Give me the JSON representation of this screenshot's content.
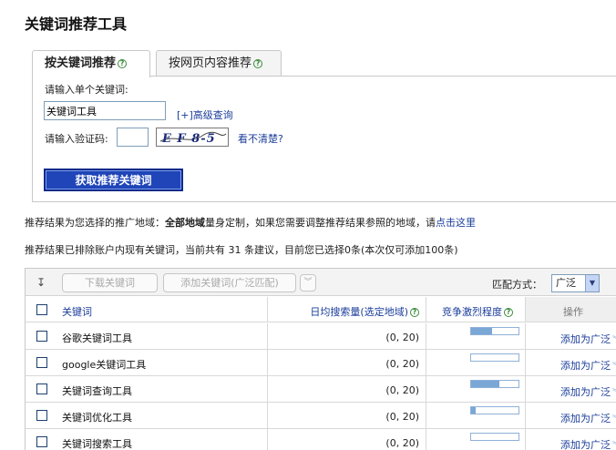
{
  "page_title": "关键词推荐工具",
  "tabs": [
    {
      "label": "按关键词推荐",
      "active": true
    },
    {
      "label": "按网页内容推荐",
      "active": false
    }
  ],
  "form": {
    "keyword_label": "请输入单个关键词:",
    "keyword_value": "关键词工具",
    "advanced_link": "[+]高级查询",
    "captcha_label": "请输入验证码:",
    "captcha_value": "",
    "captcha_text": "E F 8-5",
    "unclear_link": "看不清楚?",
    "submit_label": "获取推荐关键词"
  },
  "info": {
    "line1_prefix": "推荐结果为您选择的推广地域：",
    "line1_bold": "全部地域",
    "line1_middle": "量身定制，如果您需要调整推荐结果参照的地域，请",
    "line1_link": "点击这里",
    "line2": "推荐结果已排除账户内现有关键词，当前共有 31 条建议，目前您已选择0条(本次仅可添加100条)"
  },
  "toolbar": {
    "download_label": "下载关键词",
    "add_label": "添加关键词(广泛匹配)",
    "match_label": "匹配方式：",
    "match_value": "广泛"
  },
  "table": {
    "headers": {
      "keyword": "关键词",
      "volume": "日均搜索量(选定地域)",
      "competition": "竞争激烈程度",
      "operation": "操作"
    },
    "rows": [
      {
        "keyword": "谷歌关键词工具",
        "volume": "(0, 20)",
        "competition": 0.45,
        "action": "添加为广泛"
      },
      {
        "keyword": "google关键词工具",
        "volume": "(0, 20)",
        "competition": 0.0,
        "action": "添加为广泛"
      },
      {
        "keyword": "关键词查询工具",
        "volume": "(0, 20)",
        "competition": 0.6,
        "action": "添加为广泛"
      },
      {
        "keyword": "关键词优化工具",
        "volume": "(0, 20)",
        "competition": 0.1,
        "action": "添加为广泛"
      },
      {
        "keyword": "关键词搜索工具",
        "volume": "(0, 20)",
        "competition": 0.0,
        "action": "添加为广泛"
      }
    ]
  },
  "colors": {
    "link": "#1a3d9a",
    "button_bg": "#1f45b8",
    "bar_fill": "#7aa7d6"
  }
}
